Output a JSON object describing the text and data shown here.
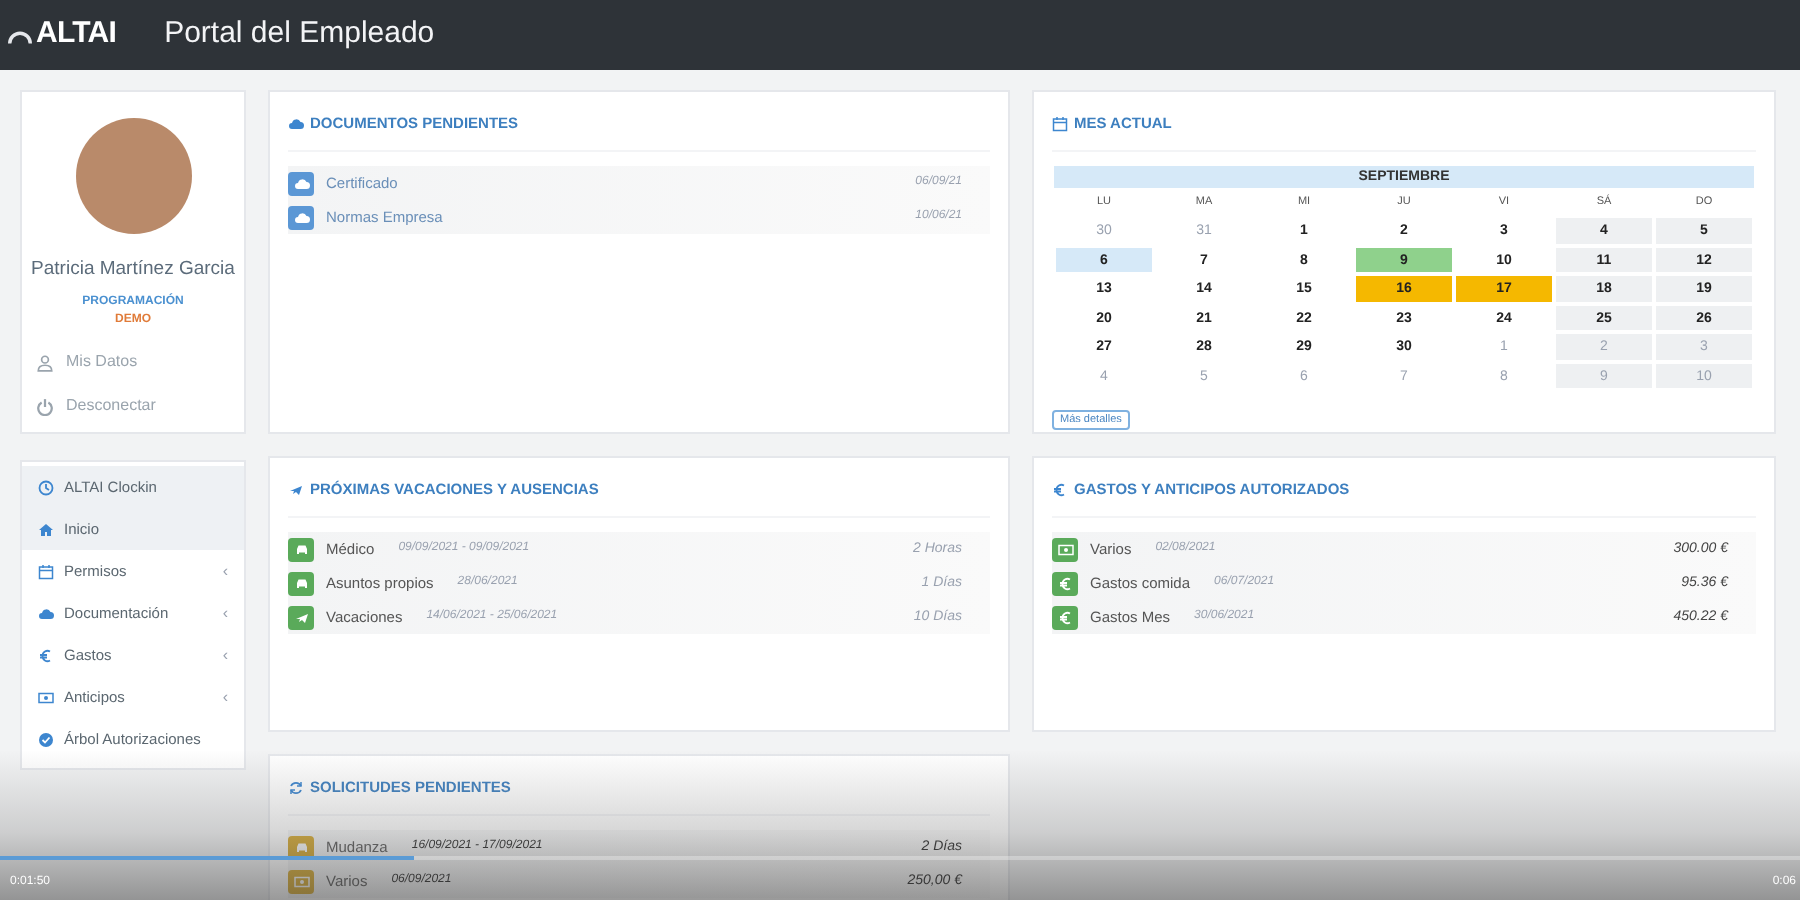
{
  "header": {
    "logo": "ALTAI",
    "title": "Portal del Empleado"
  },
  "profile": {
    "name": "Patricia Martínez Garcia",
    "department": "PROGRAMACIÓN",
    "company": "DEMO",
    "links": [
      {
        "label": "Mis Datos",
        "kind": "user"
      },
      {
        "label": "Desconectar",
        "kind": "power"
      }
    ]
  },
  "menu": [
    {
      "label": "ALTAI Clockin",
      "kind": "clock",
      "selected": true
    },
    {
      "label": "Inicio",
      "kind": "home",
      "selected": true
    },
    {
      "label": "Permisos",
      "kind": "calendar",
      "selected": false,
      "arrow": "‹"
    },
    {
      "label": "Documentación",
      "kind": "cloud",
      "selected": false,
      "arrow": "‹"
    },
    {
      "label": "Gastos",
      "kind": "euro",
      "selected": false,
      "arrow": "‹"
    },
    {
      "label": "Anticipos",
      "kind": "money",
      "selected": false,
      "arrow": "‹"
    },
    {
      "label": "Árbol Autorizaciones",
      "kind": "check",
      "selected": false
    }
  ],
  "documents": {
    "title": "DOCUMENTOS PENDIENTES",
    "rows": [
      {
        "name": "Certificado",
        "date": "06/09/21"
      },
      {
        "name": "Normas Empresa",
        "date": "10/06/21"
      }
    ]
  },
  "calendar": {
    "title": "MES ACTUAL",
    "month": "SEPTIEMBRE",
    "weekdays": [
      "LU",
      "MA",
      "MI",
      "JU",
      "VI",
      "SÁ",
      "DO"
    ],
    "weeks": [
      [
        {
          "day": "30",
          "muted": true
        },
        {
          "day": "31",
          "muted": true
        },
        {
          "day": "1",
          "muted": false
        },
        {
          "day": "2",
          "muted": false
        },
        {
          "day": "3",
          "muted": false
        },
        {
          "day": "4",
          "muted": false
        },
        {
          "day": "5",
          "muted": false
        }
      ],
      [
        {
          "day": "6",
          "muted": false,
          "color": "#d6e9f8"
        },
        {
          "day": "7",
          "muted": false
        },
        {
          "day": "8",
          "muted": false
        },
        {
          "day": "9",
          "muted": false,
          "color": "#8fd18c"
        },
        {
          "day": "10",
          "muted": false
        },
        {
          "day": "11",
          "muted": false
        },
        {
          "day": "12",
          "muted": false
        }
      ],
      [
        {
          "day": "13",
          "muted": false
        },
        {
          "day": "14",
          "muted": false
        },
        {
          "day": "15",
          "muted": false
        },
        {
          "day": "16",
          "muted": false,
          "color": "#f5b800"
        },
        {
          "day": "17",
          "muted": false,
          "color": "#f5b800"
        },
        {
          "day": "18",
          "muted": false
        },
        {
          "day": "19",
          "muted": false
        }
      ],
      [
        {
          "day": "20",
          "muted": false
        },
        {
          "day": "21",
          "muted": false
        },
        {
          "day": "22",
          "muted": false
        },
        {
          "day": "23",
          "muted": false
        },
        {
          "day": "24",
          "muted": false
        },
        {
          "day": "25",
          "muted": false
        },
        {
          "day": "26",
          "muted": false
        }
      ],
      [
        {
          "day": "27",
          "muted": false
        },
        {
          "day": "28",
          "muted": false
        },
        {
          "day": "29",
          "muted": false
        },
        {
          "day": "30",
          "muted": false
        },
        {
          "day": "1",
          "muted": true
        },
        {
          "day": "2",
          "muted": true
        },
        {
          "day": "3",
          "muted": true
        }
      ],
      [
        {
          "day": "4",
          "muted": true
        },
        {
          "day": "5",
          "muted": true
        },
        {
          "day": "6",
          "muted": true
        },
        {
          "day": "7",
          "muted": true
        },
        {
          "day": "8",
          "muted": true
        },
        {
          "day": "9",
          "muted": true
        },
        {
          "day": "10",
          "muted": true
        }
      ]
    ],
    "button": "Más detalles"
  },
  "absences": {
    "title": "PRÓXIMAS VACACIONES Y AUSENCIAS",
    "rows": [
      {
        "name": "Médico",
        "date": "09/09/2021 - 09/09/2021",
        "amount": "2 Horas",
        "kind": "car"
      },
      {
        "name": "Asuntos propios",
        "date": "28/06/2021",
        "amount": "1 Días",
        "kind": "car"
      },
      {
        "name": "Vacaciones",
        "date": "14/06/2021 - 25/06/2021",
        "amount": "10 Días",
        "kind": "plane"
      }
    ]
  },
  "expenses": {
    "title": "GASTOS Y ANTICIPOS AUTORIZADOS",
    "rows": [
      {
        "name": "Varios",
        "date": "02/08/2021",
        "amount": "300.00 €",
        "kind": "money"
      },
      {
        "name": "Gastos comida",
        "date": "06/07/2021",
        "amount": "95.36 €",
        "kind": "euro"
      },
      {
        "name": "Gastos Mes",
        "date": "30/06/2021",
        "amount": "450.22 €",
        "kind": "euro"
      }
    ]
  },
  "requests": {
    "title": "SOLICITUDES PENDIENTES",
    "rows": [
      {
        "name": "Mudanza",
        "date": "16/09/2021 - 17/09/2021",
        "amount": "2 Días",
        "kind": "car"
      },
      {
        "name": "Varios",
        "date": "06/09/2021",
        "amount": "250,00 €",
        "kind": "money"
      }
    ]
  },
  "video_player": {
    "elapsed": "0:01:50",
    "duration": "0:06",
    "level": 0.23
  }
}
